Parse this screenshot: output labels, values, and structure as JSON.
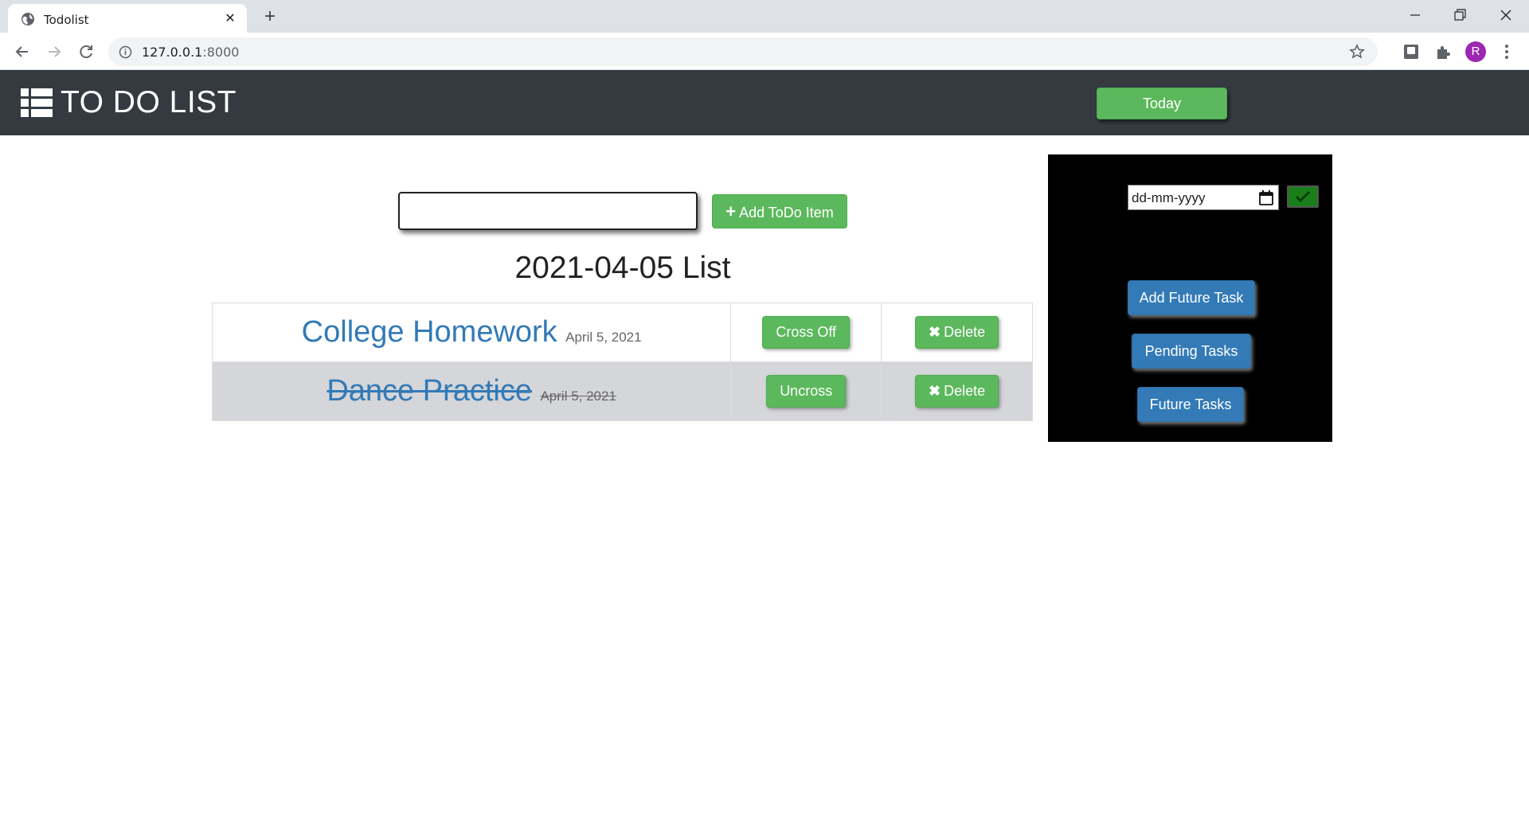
{
  "browser": {
    "tab_title": "Todolist",
    "url_host": "127.0.0.1",
    "url_port": ":8000",
    "avatar_letter": "R",
    "icons": [
      "globe-icon",
      "close-icon",
      "plus-icon",
      "back-icon",
      "forward-icon",
      "reload-icon",
      "info-icon",
      "star-icon",
      "extension-icon",
      "puzzle-icon",
      "menu-icon"
    ]
  },
  "navbar": {
    "brand": "TO DO LIST",
    "brand_icon": "list-icon",
    "today_label": "Today"
  },
  "form": {
    "input_value": "",
    "add_label": "Add ToDo Item",
    "add_icon": "plus-icon"
  },
  "list": {
    "heading": "2021-04-05 List",
    "items": [
      {
        "name": "College Homework",
        "date": "April 5, 2021",
        "done": false,
        "toggle_label": "Cross Off",
        "delete_label": "Delete"
      },
      {
        "name": "Dance Practice",
        "date": "April 5, 2021",
        "done": true,
        "toggle_label": "Uncross",
        "delete_label": "Delete"
      }
    ]
  },
  "side": {
    "date_placeholder": "dd-mm-yyyy",
    "confirm_icon": "check-icon",
    "add_future_label": "Add Future Task",
    "pending_label": "Pending Tasks",
    "future_label": "Future Tasks"
  },
  "colors": {
    "navbar": "#343a40",
    "success": "#5cb85c",
    "primary": "#337ab7",
    "side_panel": "#000000"
  }
}
